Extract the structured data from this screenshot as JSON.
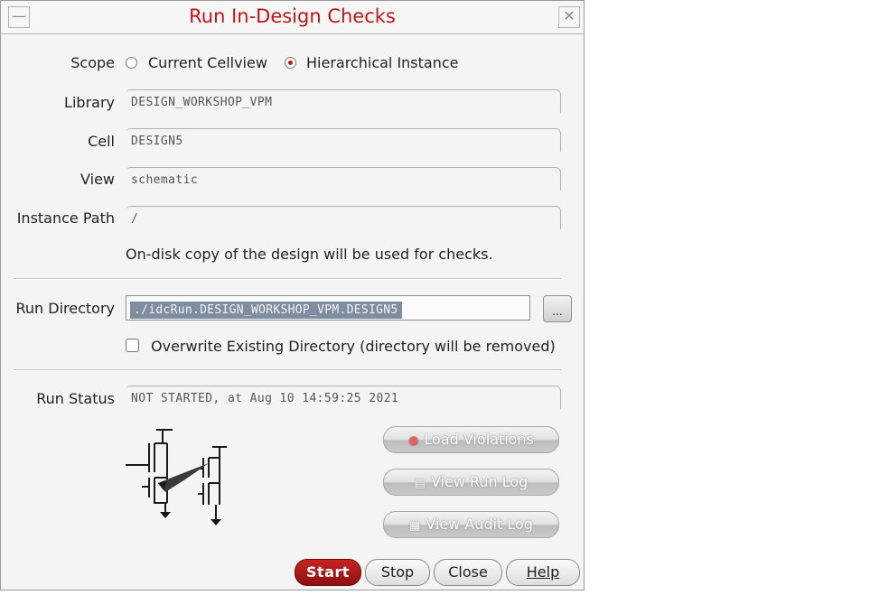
{
  "window": {
    "title": "Run In-Design Checks",
    "minimize_glyph": "—",
    "close_glyph": "✕"
  },
  "scope": {
    "label": "Scope",
    "options": [
      "Current Cellview",
      "Hierarchical Instance"
    ],
    "selected": "Hierarchical Instance"
  },
  "fields": {
    "library": {
      "label": "Library",
      "value": "DESIGN_WORKSHOP_VPM"
    },
    "cell": {
      "label": "Cell",
      "value": "DESIGN5"
    },
    "view": {
      "label": "View",
      "value": "schematic"
    },
    "instance_path": {
      "label": "Instance Path",
      "value": "/"
    }
  },
  "note": "On-disk copy of the design will be used for checks.",
  "run_directory": {
    "label": "Run Directory",
    "value": "./idcRun.DESIGN_WORKSHOP_VPM.DESIGN5",
    "browse_label": "..."
  },
  "overwrite": {
    "label": "Overwrite Existing Directory (directory will be removed)",
    "checked": false
  },
  "run_status": {
    "label": "Run Status",
    "value": "NOT STARTED, at Aug 10 14:59:25 2021"
  },
  "actions": {
    "load_violations": "Load Violations",
    "view_run_log": "View Run Log",
    "view_audit_log": "View Audit Log"
  },
  "buttons": {
    "start": "Start",
    "stop": "Stop",
    "close": "Close",
    "help": "Help"
  },
  "colors": {
    "title": "#c01515",
    "start_button": "#a81818",
    "selection": "#7f8da1"
  },
  "icons": [
    "minimize-icon",
    "close-icon",
    "schematic-illustration",
    "violations-icon",
    "log-icon",
    "audit-log-icon"
  ]
}
